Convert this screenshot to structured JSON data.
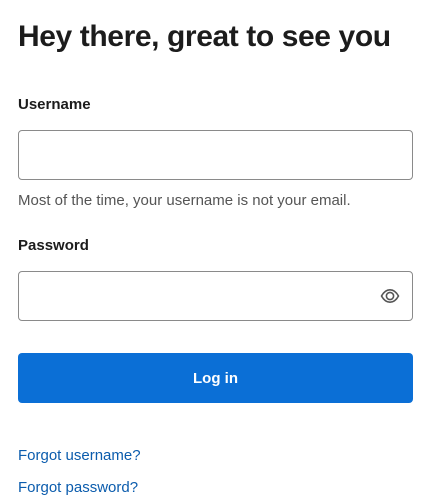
{
  "page": {
    "title": "Hey there, great to see you"
  },
  "username": {
    "label": "Username",
    "value": "",
    "placeholder": "",
    "helper": "Most of the time, your username is not your email."
  },
  "password": {
    "label": "Password",
    "value": "",
    "placeholder": "",
    "toggle_icon": "eye-icon"
  },
  "actions": {
    "login_label": "Log in",
    "forgot_username": "Forgot username?",
    "forgot_password": "Forgot password?"
  },
  "colors": {
    "primary": "#0b6fd6",
    "link": "#0b5cad",
    "border": "#8a8a8a",
    "text": "#1c1c1c",
    "helper_text": "#555555"
  }
}
